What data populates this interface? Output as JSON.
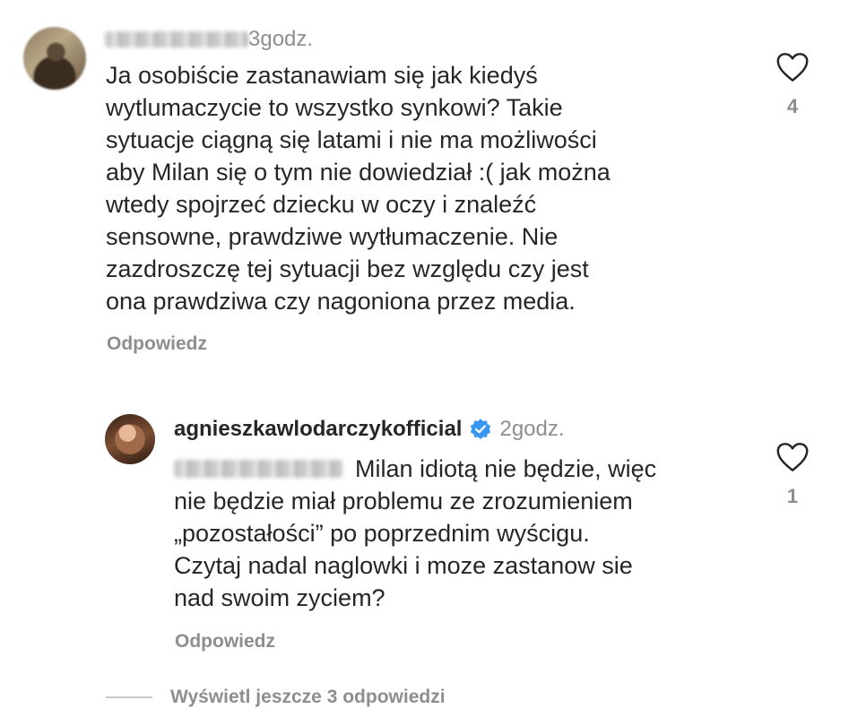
{
  "comment": {
    "author_redacted": true,
    "time": "3godz.",
    "text": "Ja osobiście zastanawiam się jak kiedyś\nwytlumaczycie to wszystko synkowi? Takie\nsytuacje ciągną się latami i nie ma możliwości\naby Milan się o tym nie dowiedział :( jak można\nwtedy spojrzeć dziecku w oczy i znaleźć\nsensowne, prawdziwe wytłumaczenie. Nie\nzazdroszczę tej sytuacji bez względu czy jest\nona prawdziwa czy nagoniona przez media.",
    "reply_label": "Odpowiedz",
    "like_count": "4",
    "like_icon": "heart-outline-icon"
  },
  "reply": {
    "username": "agnieszkawlodarczykofficial",
    "verified_icon": "verified-badge-icon",
    "verified_color": "#3897f0",
    "time": "2godz.",
    "mention_redacted": true,
    "text_line1": "Milan idiotą nie będzie, więc",
    "text_rest": "nie będzie miał problemu ze zrozumieniem\n„pozostałości” po poprzednim wyścigu.\nCzytaj nadal naglowki i moze zastanow sie\nnad swoim zyciem?",
    "reply_label": "Odpowiedz",
    "like_count": "1",
    "like_icon": "heart-outline-icon"
  },
  "thread": {
    "more_replies_label": "Wyświetl jeszcze 3 odpowiedzi"
  }
}
